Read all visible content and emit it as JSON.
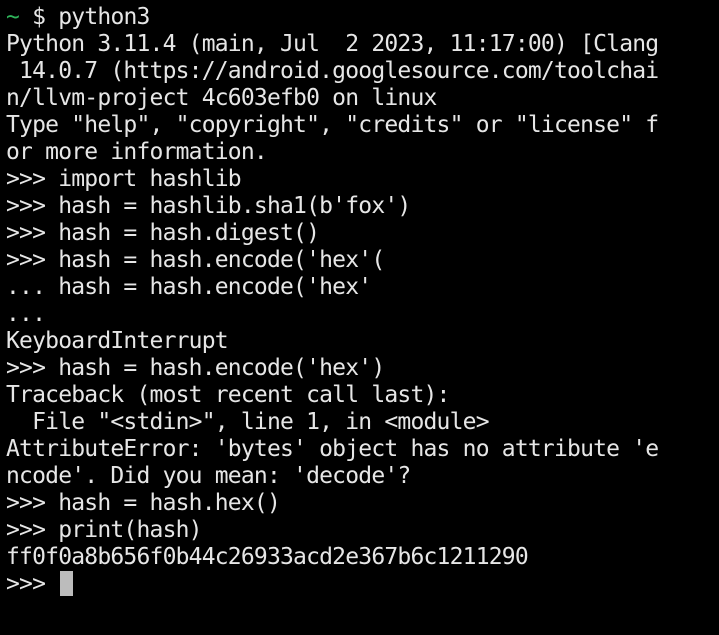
{
  "shell_prompt": {
    "tilde": "~",
    "dollar": "$",
    "command": "python3"
  },
  "lines": [
    "Python 3.11.4 (main, Jul  2 2023, 11:17:00) [Clang",
    " 14.0.7 (https://android.googlesource.com/toolchai",
    "n/llvm-project 4c603efb0 on linux",
    "Type \"help\", \"copyright\", \"credits\" or \"license\" f",
    "or more information.",
    ">>> import hashlib",
    ">>> hash = hashlib.sha1(b'fox')",
    ">>> hash = hash.digest()",
    ">>> hash = hash.encode('hex'(",
    "... hash = hash.encode('hex'",
    "...",
    "KeyboardInterrupt",
    ">>> hash = hash.encode('hex')",
    "Traceback (most recent call last):",
    "  File \"<stdin>\", line 1, in <module>",
    "AttributeError: 'bytes' object has no attribute 'e",
    "ncode'. Did you mean: 'decode'?",
    ">>> hash = hash.hex()",
    ">>> print(hash)",
    "ff0f0a8b656f0b44c26933acd2e367b6c1211290"
  ],
  "current_prompt": ">>> ",
  "colors": {
    "background": "#000000",
    "text": "#e6e6e6",
    "tilde": "#2fb45a",
    "cursor": "#bcbcbc"
  }
}
